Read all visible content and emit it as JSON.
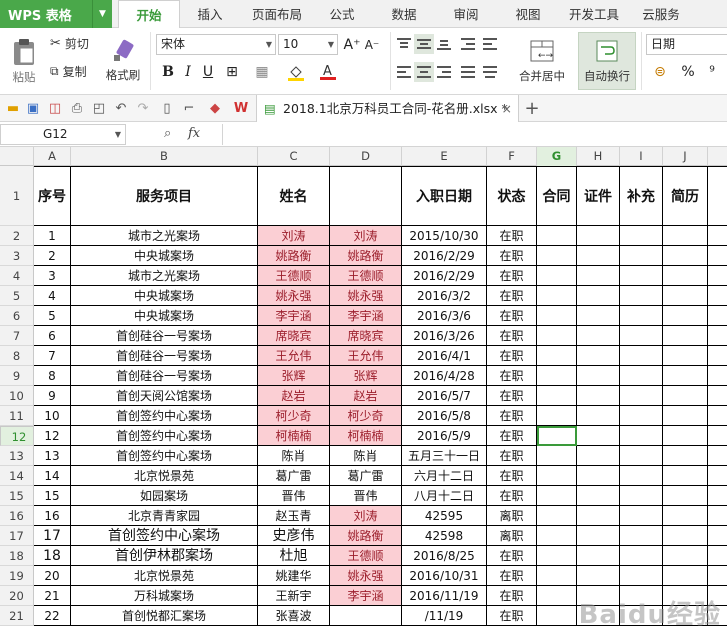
{
  "app": {
    "brand": "WPS 表格",
    "menu_tabs": [
      "开始",
      "插入",
      "页面布局",
      "公式",
      "数据",
      "审阅",
      "视图",
      "开发工具",
      "云服务"
    ],
    "active_tab": "开始"
  },
  "ribbon": {
    "paste": "粘贴",
    "cut": "剪切",
    "copy": "复制",
    "format_painter": "格式刷",
    "font_name": "宋体",
    "font_size": "10",
    "bold": "B",
    "italic": "I",
    "underline": "U",
    "font_grow": "A⁺",
    "font_shrink": "A⁻",
    "merge_center": "合并居中",
    "wrap_text": "自动换行",
    "number_format": "日期",
    "percent": "%",
    "comma": "⁹"
  },
  "quick_access": {
    "doc_tab": "2018.1北京万科员工合同-花名册.xlsx *",
    "add_tab": "+"
  },
  "formula_bar": {
    "name_box": "G12",
    "fx": "fx"
  },
  "columns": [
    "A",
    "B",
    "C",
    "D",
    "E",
    "F",
    "G",
    "H",
    "I",
    "J"
  ],
  "header_row": {
    "num": "1",
    "cells": [
      "序号",
      "服务项目",
      "姓名",
      "",
      "入职日期",
      "状态",
      "合同",
      "证件",
      "补充",
      "简历"
    ]
  },
  "rows": [
    {
      "num": "2",
      "a": "1",
      "b": "城市之光案场",
      "c": "刘涛",
      "d": "刘涛",
      "e": "2015/10/30",
      "f": "在职"
    },
    {
      "num": "3",
      "a": "2",
      "b": "中央城案场",
      "c": "姚路衡",
      "d": "姚路衡",
      "e": "2016/2/29",
      "f": "在职"
    },
    {
      "num": "4",
      "a": "3",
      "b": "城市之光案场",
      "c": "王德顺",
      "d": "王德顺",
      "e": "2016/2/29",
      "f": "在职"
    },
    {
      "num": "5",
      "a": "4",
      "b": "中央城案场",
      "c": "姚永强",
      "d": "姚永强",
      "e": "2016/3/2",
      "f": "在职"
    },
    {
      "num": "6",
      "a": "5",
      "b": "中央城案场",
      "c": "李宇涵",
      "d": "李宇涵",
      "e": "2016/3/6",
      "f": "在职"
    },
    {
      "num": "7",
      "a": "6",
      "b": "首创硅谷一号案场",
      "c": "席晓宾",
      "d": "席晓宾",
      "e": "2016/3/26",
      "f": "在职"
    },
    {
      "num": "8",
      "a": "7",
      "b": "首创硅谷一号案场",
      "c": "王允伟",
      "d": "王允伟",
      "e": "2016/4/1",
      "f": "在职"
    },
    {
      "num": "9",
      "a": "8",
      "b": "首创硅谷一号案场",
      "c": "张辉",
      "d": "张辉",
      "e": "2016/4/28",
      "f": "在职"
    },
    {
      "num": "10",
      "a": "9",
      "b": "首创天阅公馆案场",
      "c": "赵岩",
      "d": "赵岩",
      "e": "2016/5/7",
      "f": "在职"
    },
    {
      "num": "11",
      "a": "10",
      "b": "首创签约中心案场",
      "c": "柯少奇",
      "d": "柯少奇",
      "e": "2016/5/8",
      "f": "在职"
    },
    {
      "num": "12",
      "a": "12",
      "b": "首创签约中心案场",
      "c": "柯楠楠",
      "d": "柯楠楠",
      "e": "2016/5/9",
      "f": "在职"
    },
    {
      "num": "13",
      "a": "13",
      "b": "首创签约中心案场",
      "c": "陈肖",
      "d": "陈肖",
      "e": "五月三十一日",
      "f": "在职"
    },
    {
      "num": "14",
      "a": "14",
      "b": "北京悦景苑",
      "c": "葛广雷",
      "d": "葛广雷",
      "e": "六月十二日",
      "f": "在职"
    },
    {
      "num": "15",
      "a": "15",
      "b": "如园案场",
      "c": "晋伟",
      "d": "晋伟",
      "e": "八月十二日",
      "f": "在职"
    },
    {
      "num": "16",
      "a": "16",
      "b": "北京青青家园",
      "c": "赵玉青",
      "d": "刘涛",
      "e": "42595",
      "f": "离职"
    },
    {
      "num": "17",
      "a": "17",
      "b": "首创签约中心案场",
      "c": "史彦伟",
      "d": "姚路衡",
      "e": "42598",
      "f": "离职"
    },
    {
      "num": "18",
      "a": "18",
      "b": "首创伊林郡案场",
      "c": "杜旭",
      "d": "王德顺",
      "e": "2016/8/25",
      "f": "在职"
    },
    {
      "num": "19",
      "a": "20",
      "b": "北京悦景苑",
      "c": "姚建华",
      "d": "姚永强",
      "e": "2016/10/31",
      "f": "在职"
    },
    {
      "num": "20",
      "a": "21",
      "b": "万科城案场",
      "c": "王新宇",
      "d": "李宇涵",
      "e": "2016/11/19",
      "f": "在职"
    },
    {
      "num": "21",
      "a": "22",
      "b": "首创悦都汇案场",
      "c": "张喜波",
      "d": "",
      "e": "/11/19",
      "f": "在职"
    }
  ],
  "colors": {
    "accent": "#3a9a3a",
    "pink_fill": "#fbcfd4",
    "pink_text": "#9c1f2c"
  },
  "watermark": "Baidu经验"
}
